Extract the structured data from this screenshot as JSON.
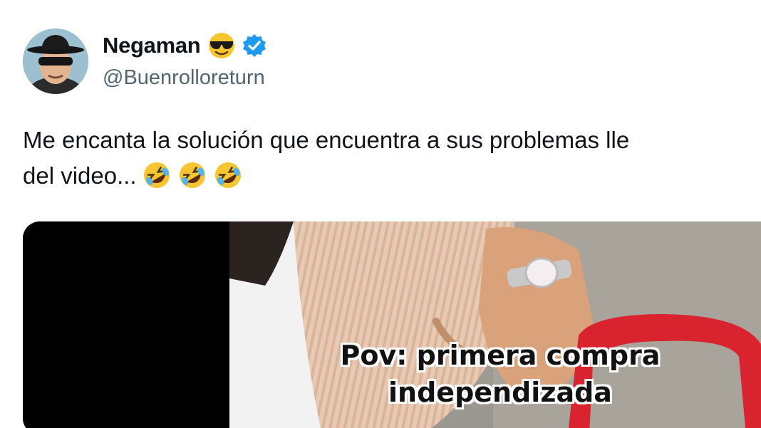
{
  "tweet": {
    "author": {
      "display_name": "Negaman",
      "handle": "@Buenrolloreturn",
      "name_emoji_icon": "smiling-face-with-sunglasses-icon",
      "verified_icon": "verified-badge-icon"
    },
    "text_line_1": "Me encanta la solución que encuentra a sus problemas lle",
    "text_line_2": "del video...",
    "text_emoji_icon": "rolling-on-floor-laughing-icon",
    "media": {
      "caption_line_1": "Pov: primera compra",
      "caption_line_2": "independizada"
    }
  },
  "colors": {
    "text": "#0f1419",
    "secondary_text": "#536471",
    "verified_blue": "#1d9bf0",
    "cart_red": "#d9232e"
  }
}
